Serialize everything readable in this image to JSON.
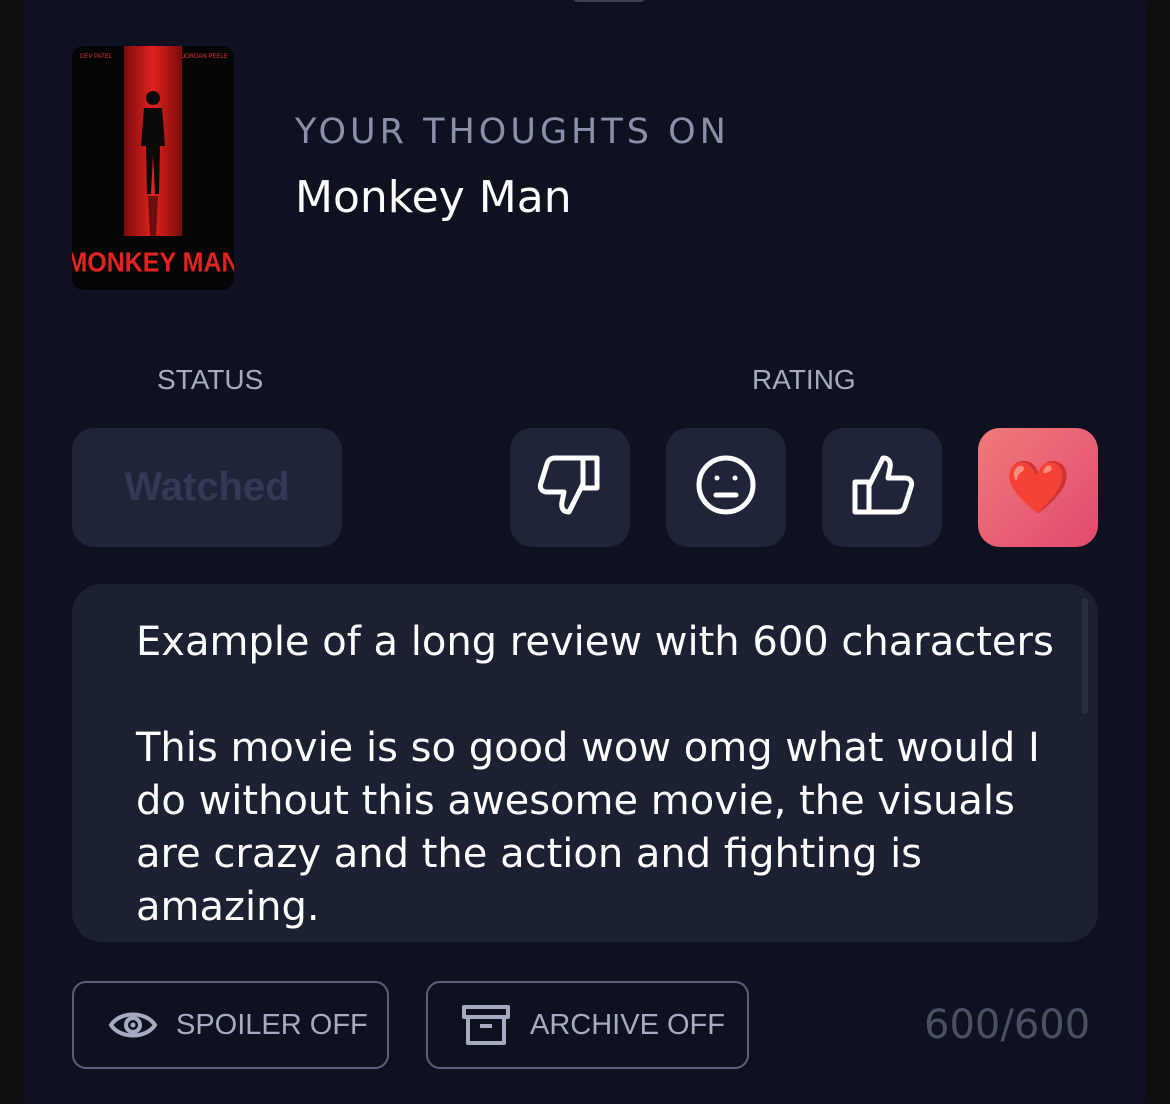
{
  "header": {
    "kicker": "YOUR THOUGHTS ON",
    "title": "Monkey Man"
  },
  "poster": {
    "top_left_credit": "DEV PATEL",
    "top_right_credit": "JORDAN PEELE",
    "logo_text": "MONKEY MAN"
  },
  "status": {
    "label": "STATUS",
    "value": "Watched"
  },
  "rating": {
    "label": "RATING",
    "options": [
      {
        "name": "thumbs-down-icon",
        "selected": false
      },
      {
        "name": "neutral-face-icon",
        "selected": false
      },
      {
        "name": "thumbs-up-icon",
        "selected": false
      },
      {
        "name": "heart-icon",
        "selected": true
      }
    ],
    "heart": "❤️"
  },
  "review": {
    "text": "Example of a long review with 600 characters\n\nThis movie is so good wow omg what would I do without this awesome movie, the visuals are crazy and the action and fighting is amazing."
  },
  "toggles": {
    "spoiler_label": "SPOILER OFF",
    "archive_label": "ARCHIVE OFF"
  },
  "counter": "600/600",
  "colors": {
    "sheet_bg": "#0e1120",
    "button_bg": "#1f2438",
    "accent_gradient_start": "#f07a7a",
    "accent_gradient_end": "#e24a6f",
    "muted_text": "#a6abc2"
  }
}
